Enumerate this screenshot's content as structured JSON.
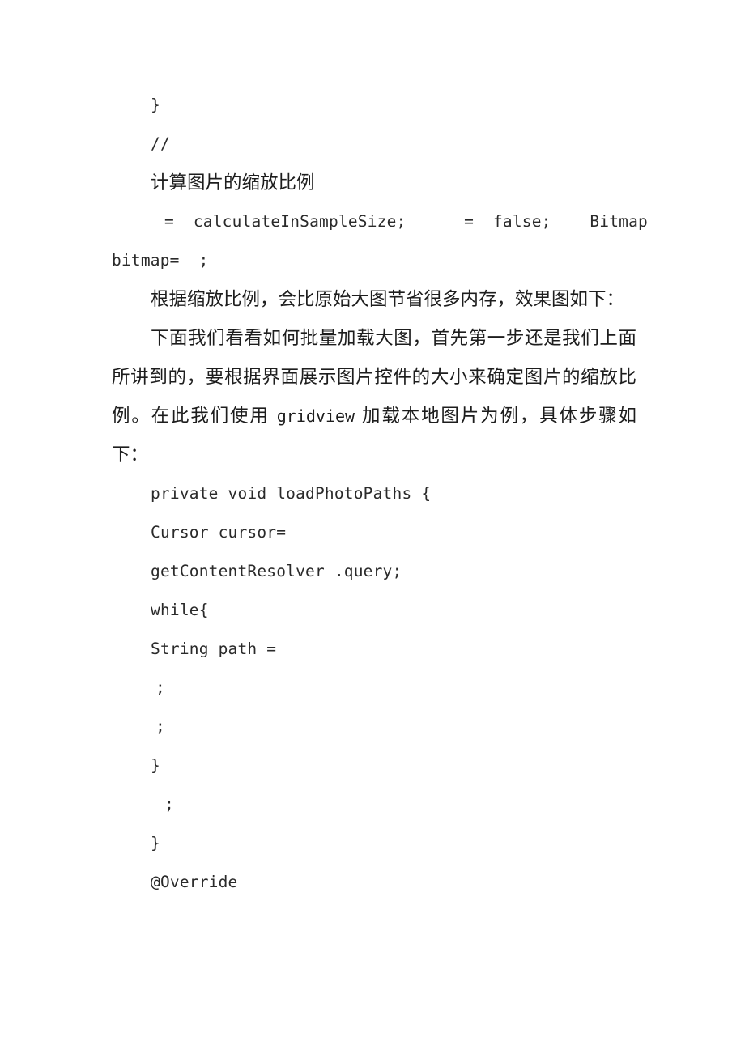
{
  "document": {
    "page_background": "#ffffff",
    "text_color": "#1d1d1d",
    "lines": {
      "close_brace_1": "}",
      "comment_slashes": "//",
      "comment_cjk": "计算图片的缩放比例",
      "code_calc": "=  calculateInSampleSize;      =  false;    Bitmap",
      "code_bitmap": "bitmap=  ;",
      "para_1": "根据缩放比例，会比原始大图节省很多内存，效果图如下：",
      "para_2_part1": "下面我们看看如何批量加载大图，首先第一步还是我们上面所讲到的，要根据界面展示图片控件的大小来确定图片的缩放比例。在此我们使用 ",
      "para_2_mono": "gridview",
      "para_2_part2": " 加载本地图片为例，具体步骤如下：",
      "code_private": "private void loadPhotoPaths {",
      "code_cursor": "Cursor cursor=",
      "code_query": "getContentResolver .query;",
      "code_while": "while{",
      "code_string_path": "String path =",
      "code_semi_1": ";",
      "code_semi_2": ";",
      "code_close_brace_2": "}",
      "code_semi_3": ";",
      "code_close_brace_3": "}",
      "code_override": "@Override"
    }
  }
}
